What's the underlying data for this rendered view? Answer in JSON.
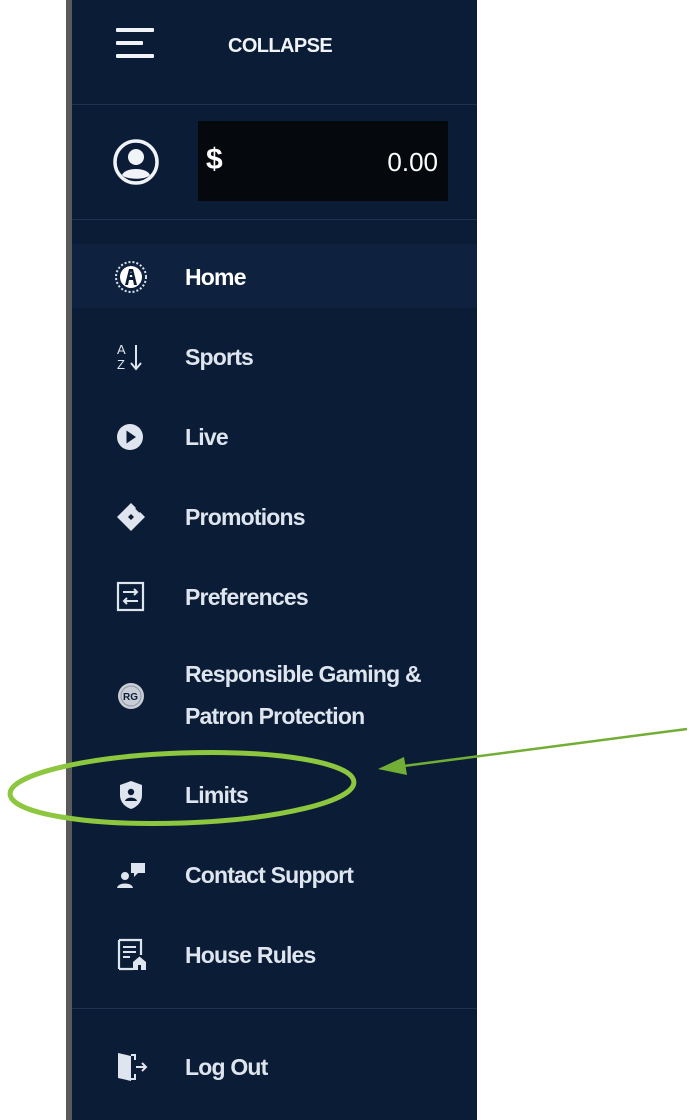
{
  "header": {
    "collapse_label": "COLLAPSE"
  },
  "account": {
    "currency_symbol": "$",
    "balance": "0.00"
  },
  "menu": {
    "items": [
      {
        "label": "Home",
        "icon": "brand-logo-icon"
      },
      {
        "label": "Sports",
        "icon": "sort-az-icon"
      },
      {
        "label": "Live",
        "icon": "play-circle-icon"
      },
      {
        "label": "Promotions",
        "icon": "ticket-icon"
      },
      {
        "label": "Preferences",
        "icon": "preferences-icon"
      },
      {
        "label_line1": "Responsible Gaming &",
        "label_line2": "Patron Protection",
        "icon": "rg-badge-icon"
      },
      {
        "label": "Limits",
        "icon": "shield-icon"
      },
      {
        "label": "Contact Support",
        "icon": "support-chat-icon"
      },
      {
        "label": "House Rules",
        "icon": "house-rules-icon"
      }
    ],
    "logout_label": "Log Out"
  },
  "colors": {
    "sidebar_bg": "#0b1d36",
    "annotation_green": "#8dc63f"
  }
}
